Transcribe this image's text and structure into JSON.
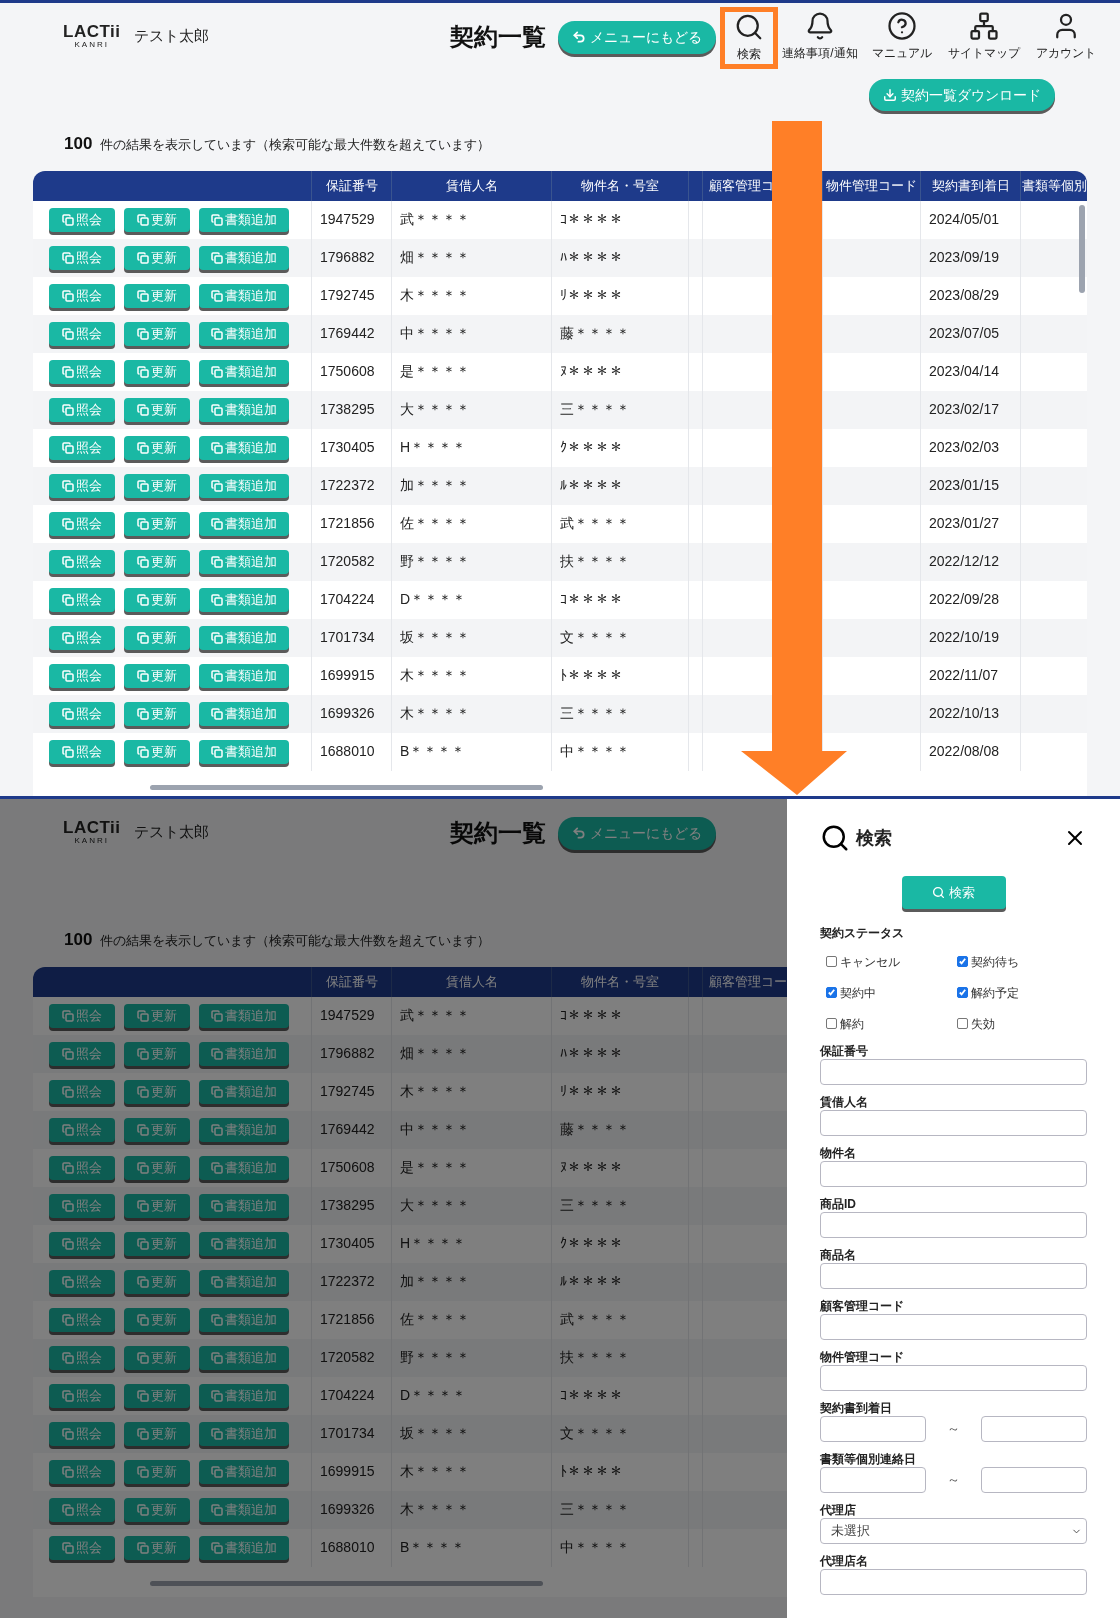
{
  "top_screen": {
    "logo": "LACTii",
    "logo_sub": "KANRI",
    "user": "テスト太郎",
    "title": "契約一覧",
    "back_button": "メニューにもどる",
    "nav": [
      {
        "label": "検索",
        "highlighted": true
      },
      {
        "label": "連絡事項/通知",
        "highlighted": false
      },
      {
        "label": "マニュアル",
        "highlighted": false
      },
      {
        "label": "サイトマップ",
        "highlighted": false
      },
      {
        "label": "アカウント",
        "highlighted": false
      }
    ],
    "download_button": "契約一覧ダウンロード",
    "result_count": "100",
    "result_text": "件の結果を表示しています（検索可能な最大件数を超えています）",
    "columns": [
      "保証番号",
      "賃借人名",
      "物件名・号室",
      "顧客管理コ",
      "物件管理コード",
      "契約書到着日",
      "書類等個別"
    ],
    "rows": [
      {
        "actions": [
          "照会",
          "更新",
          "書類追加"
        ],
        "guarantee_no": "1947529",
        "tenant": "武＊＊＊＊",
        "property": "ｺ＊＊＊＊",
        "arrival_date": "2024/05/01"
      },
      {
        "actions": [
          "照会",
          "更新",
          "書類追加"
        ],
        "guarantee_no": "1796882",
        "tenant": "畑＊＊＊＊",
        "property": "ﾊ＊＊＊＊",
        "arrival_date": "2023/09/19"
      },
      {
        "actions": [
          "照会",
          "更新",
          "書類追加"
        ],
        "guarantee_no": "1792745",
        "tenant": "木＊＊＊＊",
        "property": "ﾘ＊＊＊＊",
        "arrival_date": "2023/08/29"
      },
      {
        "actions": [
          "照会",
          "更新",
          "書類追加"
        ],
        "guarantee_no": "1769442",
        "tenant": "中＊＊＊＊",
        "property": "藤＊＊＊＊",
        "arrival_date": "2023/07/05"
      },
      {
        "actions": [
          "照会",
          "更新",
          "書類追加"
        ],
        "guarantee_no": "1750608",
        "tenant": "是＊＊＊＊",
        "property": "ﾇ＊＊＊＊",
        "arrival_date": "2023/04/14"
      },
      {
        "actions": [
          "照会",
          "更新",
          "書類追加"
        ],
        "guarantee_no": "1738295",
        "tenant": "大＊＊＊＊",
        "property": "三＊＊＊＊",
        "arrival_date": "2023/02/17"
      },
      {
        "actions": [
          "照会",
          "更新",
          "書類追加"
        ],
        "guarantee_no": "1730405",
        "tenant": "H＊＊＊＊",
        "property": "ｸ＊＊＊＊",
        "arrival_date": "2023/02/03"
      },
      {
        "actions": [
          "照会",
          "更新",
          "書類追加"
        ],
        "guarantee_no": "1722372",
        "tenant": "加＊＊＊＊",
        "property": "ﾙ＊＊＊＊",
        "arrival_date": "2023/01/15"
      },
      {
        "actions": [
          "照会",
          "更新",
          "書類追加"
        ],
        "guarantee_no": "1721856",
        "tenant": "佐＊＊＊＊",
        "property": "武＊＊＊＊",
        "arrival_date": "2023/01/27"
      },
      {
        "actions": [
          "照会",
          "更新",
          "書類追加"
        ],
        "guarantee_no": "1720582",
        "tenant": "野＊＊＊＊",
        "property": "扶＊＊＊＊",
        "arrival_date": "2022/12/12"
      },
      {
        "actions": [
          "照会",
          "更新",
          "書類追加"
        ],
        "guarantee_no": "1704224",
        "tenant": "D＊＊＊＊",
        "property": "ｺ＊＊＊＊",
        "arrival_date": "2022/09/28"
      },
      {
        "actions": [
          "照会",
          "更新",
          "書類追加"
        ],
        "guarantee_no": "1701734",
        "tenant": "坂＊＊＊＊",
        "property": "文＊＊＊＊",
        "arrival_date": "2022/10/19"
      },
      {
        "actions": [
          "照会",
          "更新",
          "書類追加"
        ],
        "guarantee_no": "1699915",
        "tenant": "木＊＊＊＊",
        "property": "ﾄ＊＊＊＊",
        "arrival_date": "2022/11/07"
      },
      {
        "actions": [
          "照会",
          "更新",
          "書類追加"
        ],
        "guarantee_no": "1699326",
        "tenant": "木＊＊＊＊",
        "property": "三＊＊＊＊",
        "arrival_date": "2022/10/13"
      },
      {
        "actions": [
          "照会",
          "更新",
          "書類追加"
        ],
        "guarantee_no": "1688010",
        "tenant": "B＊＊＊＊",
        "property": "中＊＊＊＊",
        "arrival_date": "2022/08/08"
      }
    ]
  },
  "bottom_screen": {
    "logo": "LACTii",
    "logo_sub": "KANRI",
    "user": "テスト太郎",
    "title": "契約一覧",
    "back_button": "メニューにもどる",
    "result_count": "100",
    "result_text": "件の結果を表示しています（検索可能な最大件数を超えています）",
    "columns": [
      "保証番号",
      "賃借人名",
      "物件名・号室",
      "顧客管理コー"
    ],
    "rows": [
      {
        "actions": [
          "照会",
          "更新",
          "書類追加"
        ],
        "guarantee_no": "1947529",
        "tenant": "武＊＊＊＊",
        "property": "ｺ＊＊＊＊"
      },
      {
        "actions": [
          "照会",
          "更新",
          "書類追加"
        ],
        "guarantee_no": "1796882",
        "tenant": "畑＊＊＊＊",
        "property": "ﾊ＊＊＊＊"
      },
      {
        "actions": [
          "照会",
          "更新",
          "書類追加"
        ],
        "guarantee_no": "1792745",
        "tenant": "木＊＊＊＊",
        "property": "ﾘ＊＊＊＊"
      },
      {
        "actions": [
          "照会",
          "更新",
          "書類追加"
        ],
        "guarantee_no": "1769442",
        "tenant": "中＊＊＊＊",
        "property": "藤＊＊＊＊"
      },
      {
        "actions": [
          "照会",
          "更新",
          "書類追加"
        ],
        "guarantee_no": "1750608",
        "tenant": "是＊＊＊＊",
        "property": "ﾇ＊＊＊＊"
      },
      {
        "actions": [
          "照会",
          "更新",
          "書類追加"
        ],
        "guarantee_no": "1738295",
        "tenant": "大＊＊＊＊",
        "property": "三＊＊＊＊"
      },
      {
        "actions": [
          "照会",
          "更新",
          "書類追加"
        ],
        "guarantee_no": "1730405",
        "tenant": "H＊＊＊＊",
        "property": "ｸ＊＊＊＊"
      },
      {
        "actions": [
          "照会",
          "更新",
          "書類追加"
        ],
        "guarantee_no": "1722372",
        "tenant": "加＊＊＊＊",
        "property": "ﾙ＊＊＊＊"
      },
      {
        "actions": [
          "照会",
          "更新",
          "書類追加"
        ],
        "guarantee_no": "1721856",
        "tenant": "佐＊＊＊＊",
        "property": "武＊＊＊＊"
      },
      {
        "actions": [
          "照会",
          "更新",
          "書類追加"
        ],
        "guarantee_no": "1720582",
        "tenant": "野＊＊＊＊",
        "property": "扶＊＊＊＊"
      },
      {
        "actions": [
          "照会",
          "更新",
          "書類追加"
        ],
        "guarantee_no": "1704224",
        "tenant": "D＊＊＊＊",
        "property": "ｺ＊＊＊＊"
      },
      {
        "actions": [
          "照会",
          "更新",
          "書類追加"
        ],
        "guarantee_no": "1701734",
        "tenant": "坂＊＊＊＊",
        "property": "文＊＊＊＊"
      },
      {
        "actions": [
          "照会",
          "更新",
          "書類追加"
        ],
        "guarantee_no": "1699915",
        "tenant": "木＊＊＊＊",
        "property": "ﾄ＊＊＊＊"
      },
      {
        "actions": [
          "照会",
          "更新",
          "書類追加"
        ],
        "guarantee_no": "1699326",
        "tenant": "木＊＊＊＊",
        "property": "三＊＊＊＊"
      },
      {
        "actions": [
          "照会",
          "更新",
          "書類追加"
        ],
        "guarantee_no": "1688010",
        "tenant": "B＊＊＊＊",
        "property": "中＊＊＊＊"
      }
    ],
    "search_panel": {
      "title": "検索",
      "search_button": "検索",
      "status_label": "契約ステータス",
      "statuses": [
        {
          "label": "キャンセル",
          "checked": false
        },
        {
          "label": "契約待ち",
          "checked": true
        },
        {
          "label": "契約中",
          "checked": true
        },
        {
          "label": "解約予定",
          "checked": true
        },
        {
          "label": "解約",
          "checked": false
        },
        {
          "label": "失効",
          "checked": false
        }
      ],
      "fields": [
        {
          "kind": "text",
          "label": "保証番号"
        },
        {
          "kind": "text",
          "label": "賃借人名"
        },
        {
          "kind": "text",
          "label": "物件名"
        },
        {
          "kind": "text",
          "label": "商品ID"
        },
        {
          "kind": "text",
          "label": "商品名"
        },
        {
          "kind": "text",
          "label": "顧客管理コード"
        },
        {
          "kind": "text",
          "label": "物件管理コード"
        },
        {
          "kind": "range",
          "label": "契約書到着日",
          "separator": "～"
        },
        {
          "kind": "range",
          "label": "書類等個別連絡日",
          "separator": "～"
        },
        {
          "kind": "select",
          "label": "代理店",
          "value": "未選択"
        },
        {
          "kind": "text",
          "label": "代理店名"
        }
      ]
    }
  }
}
